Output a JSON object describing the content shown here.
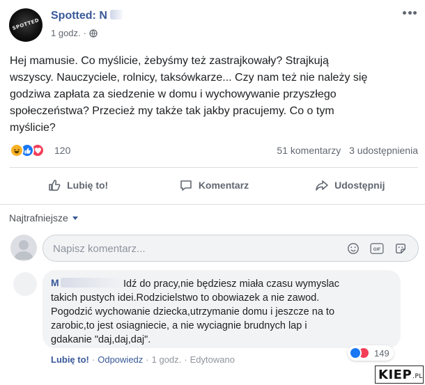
{
  "post": {
    "page_name": "Spotted: N",
    "time": "1 godz.",
    "time_separator": "·",
    "text": "Hej mamusie. Co myślicie, żebyśmy też zastrajkowały? Strajkują\nwszyscy. Nauczyciele, rolnicy, taksówkarze... Czy nam też nie należy się\ngodziwa zapłata za siedzenie w domu i wychowywanie przyszłego\nspołeczeństwa? Przecież my także tak jakby pracujemy. Co o tym\nmyślicie?",
    "reaction_count": "120",
    "comments_count": "51 komentarzy",
    "shares_count": "3 udostępnienia"
  },
  "actions": {
    "like": "Lubię to!",
    "comment": "Komentarz",
    "share": "Udostępnij"
  },
  "comments_section": {
    "sort_label": "Najtrafniejsze",
    "input_placeholder": "Napisz komentarz...",
    "input_icons": [
      "smiley-icon",
      "gif-icon",
      "sticker-icon"
    ]
  },
  "comment": {
    "author_initial": "M",
    "text": "Idź do pracy,nie będziesz miała czasu wymyslac\ntakich pustych idei.Rodzicielstwo to obowiazek a nie zawod.\nPogodzić wychowanie dziecka,utrzymanie domu i jeszcze na to\nzarobic,to jest osiagniecie, a nie wyciagnie brudnych lap i\ngdakanie \"daj,daj,daj\".",
    "reaction_count": "149",
    "like_label": "Lubię to!",
    "reply_label": "Odpowiedz",
    "time": "1 godz.",
    "edited_label": "Edytowano",
    "separator": "·"
  },
  "watermark": {
    "main": "KIEP",
    "suffix": ".PL"
  },
  "colors": {
    "link_blue": "#385898",
    "like_blue": "#1877f2",
    "love_red": "#f33e58",
    "haha_yellow": "#f7b125",
    "muted_gray": "#606770"
  }
}
